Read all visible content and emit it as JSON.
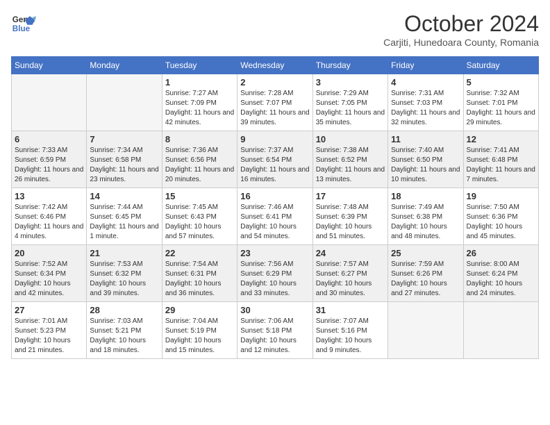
{
  "header": {
    "logo_line1": "General",
    "logo_line2": "Blue",
    "month": "October 2024",
    "location": "Carjiti, Hunedoara County, Romania"
  },
  "weekdays": [
    "Sunday",
    "Monday",
    "Tuesday",
    "Wednesday",
    "Thursday",
    "Friday",
    "Saturday"
  ],
  "weeks": [
    [
      {
        "day": "",
        "info": ""
      },
      {
        "day": "",
        "info": ""
      },
      {
        "day": "1",
        "info": "Sunrise: 7:27 AM\nSunset: 7:09 PM\nDaylight: 11 hours and 42 minutes."
      },
      {
        "day": "2",
        "info": "Sunrise: 7:28 AM\nSunset: 7:07 PM\nDaylight: 11 hours and 39 minutes."
      },
      {
        "day": "3",
        "info": "Sunrise: 7:29 AM\nSunset: 7:05 PM\nDaylight: 11 hours and 35 minutes."
      },
      {
        "day": "4",
        "info": "Sunrise: 7:31 AM\nSunset: 7:03 PM\nDaylight: 11 hours and 32 minutes."
      },
      {
        "day": "5",
        "info": "Sunrise: 7:32 AM\nSunset: 7:01 PM\nDaylight: 11 hours and 29 minutes."
      }
    ],
    [
      {
        "day": "6",
        "info": "Sunrise: 7:33 AM\nSunset: 6:59 PM\nDaylight: 11 hours and 26 minutes."
      },
      {
        "day": "7",
        "info": "Sunrise: 7:34 AM\nSunset: 6:58 PM\nDaylight: 11 hours and 23 minutes."
      },
      {
        "day": "8",
        "info": "Sunrise: 7:36 AM\nSunset: 6:56 PM\nDaylight: 11 hours and 20 minutes."
      },
      {
        "day": "9",
        "info": "Sunrise: 7:37 AM\nSunset: 6:54 PM\nDaylight: 11 hours and 16 minutes."
      },
      {
        "day": "10",
        "info": "Sunrise: 7:38 AM\nSunset: 6:52 PM\nDaylight: 11 hours and 13 minutes."
      },
      {
        "day": "11",
        "info": "Sunrise: 7:40 AM\nSunset: 6:50 PM\nDaylight: 11 hours and 10 minutes."
      },
      {
        "day": "12",
        "info": "Sunrise: 7:41 AM\nSunset: 6:48 PM\nDaylight: 11 hours and 7 minutes."
      }
    ],
    [
      {
        "day": "13",
        "info": "Sunrise: 7:42 AM\nSunset: 6:46 PM\nDaylight: 11 hours and 4 minutes."
      },
      {
        "day": "14",
        "info": "Sunrise: 7:44 AM\nSunset: 6:45 PM\nDaylight: 11 hours and 1 minute."
      },
      {
        "day": "15",
        "info": "Sunrise: 7:45 AM\nSunset: 6:43 PM\nDaylight: 10 hours and 57 minutes."
      },
      {
        "day": "16",
        "info": "Sunrise: 7:46 AM\nSunset: 6:41 PM\nDaylight: 10 hours and 54 minutes."
      },
      {
        "day": "17",
        "info": "Sunrise: 7:48 AM\nSunset: 6:39 PM\nDaylight: 10 hours and 51 minutes."
      },
      {
        "day": "18",
        "info": "Sunrise: 7:49 AM\nSunset: 6:38 PM\nDaylight: 10 hours and 48 minutes."
      },
      {
        "day": "19",
        "info": "Sunrise: 7:50 AM\nSunset: 6:36 PM\nDaylight: 10 hours and 45 minutes."
      }
    ],
    [
      {
        "day": "20",
        "info": "Sunrise: 7:52 AM\nSunset: 6:34 PM\nDaylight: 10 hours and 42 minutes."
      },
      {
        "day": "21",
        "info": "Sunrise: 7:53 AM\nSunset: 6:32 PM\nDaylight: 10 hours and 39 minutes."
      },
      {
        "day": "22",
        "info": "Sunrise: 7:54 AM\nSunset: 6:31 PM\nDaylight: 10 hours and 36 minutes."
      },
      {
        "day": "23",
        "info": "Sunrise: 7:56 AM\nSunset: 6:29 PM\nDaylight: 10 hours and 33 minutes."
      },
      {
        "day": "24",
        "info": "Sunrise: 7:57 AM\nSunset: 6:27 PM\nDaylight: 10 hours and 30 minutes."
      },
      {
        "day": "25",
        "info": "Sunrise: 7:59 AM\nSunset: 6:26 PM\nDaylight: 10 hours and 27 minutes."
      },
      {
        "day": "26",
        "info": "Sunrise: 8:00 AM\nSunset: 6:24 PM\nDaylight: 10 hours and 24 minutes."
      }
    ],
    [
      {
        "day": "27",
        "info": "Sunrise: 7:01 AM\nSunset: 5:23 PM\nDaylight: 10 hours and 21 minutes."
      },
      {
        "day": "28",
        "info": "Sunrise: 7:03 AM\nSunset: 5:21 PM\nDaylight: 10 hours and 18 minutes."
      },
      {
        "day": "29",
        "info": "Sunrise: 7:04 AM\nSunset: 5:19 PM\nDaylight: 10 hours and 15 minutes."
      },
      {
        "day": "30",
        "info": "Sunrise: 7:06 AM\nSunset: 5:18 PM\nDaylight: 10 hours and 12 minutes."
      },
      {
        "day": "31",
        "info": "Sunrise: 7:07 AM\nSunset: 5:16 PM\nDaylight: 10 hours and 9 minutes."
      },
      {
        "day": "",
        "info": ""
      },
      {
        "day": "",
        "info": ""
      }
    ]
  ]
}
